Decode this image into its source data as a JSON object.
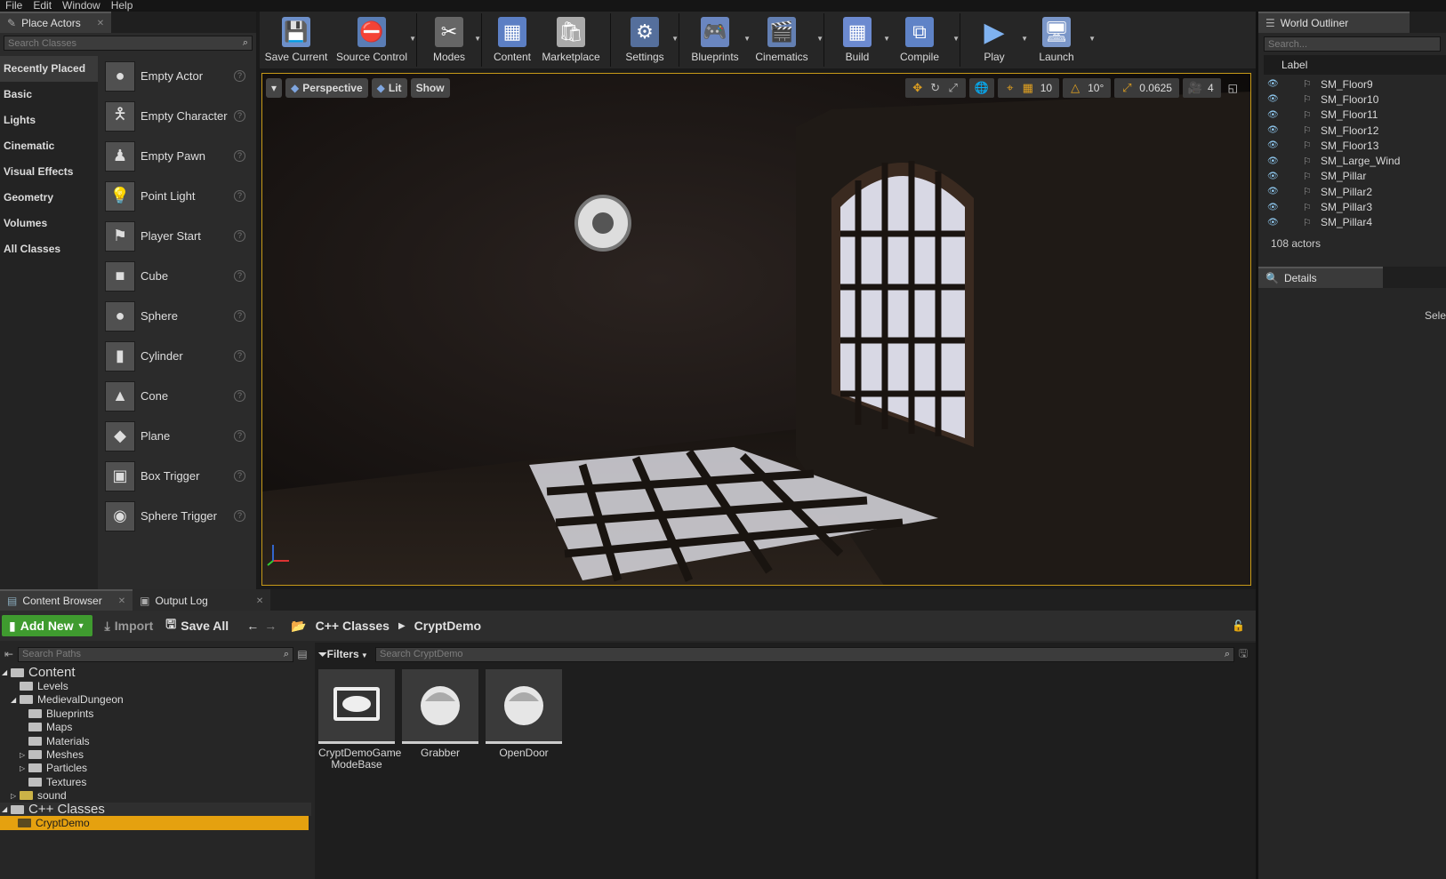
{
  "menu": [
    "File",
    "Edit",
    "Window",
    "Help"
  ],
  "place_actors": {
    "tab": "Place Actors",
    "search_placeholder": "Search Classes",
    "categories": [
      "Recently Placed",
      "Basic",
      "Lights",
      "Cinematic",
      "Visual Effects",
      "Geometry",
      "Volumes",
      "All Classes"
    ],
    "items": [
      "Empty Actor",
      "Empty Character",
      "Empty Pawn",
      "Point Light",
      "Player Start",
      "Cube",
      "Sphere",
      "Cylinder",
      "Cone",
      "Plane",
      "Box Trigger",
      "Sphere Trigger"
    ]
  },
  "toolbar": [
    "Save Current",
    "Source Control",
    "Modes",
    "Content",
    "Marketplace",
    "Settings",
    "Blueprints",
    "Cinematics",
    "Build",
    "Compile",
    "Play",
    "Launch"
  ],
  "viewport": {
    "perspective": "Perspective",
    "lit": "Lit",
    "show": "Show",
    "grid_snap": "10",
    "rot_snap": "10°",
    "scale_snap": "0.0625",
    "cam_speed": "4"
  },
  "outliner": {
    "tab": "World Outliner",
    "search_placeholder": "Search...",
    "column": "Label",
    "items": [
      "SM_Floor9",
      "SM_Floor10",
      "SM_Floor11",
      "SM_Floor12",
      "SM_Floor13",
      "SM_Large_Wind",
      "SM_Pillar",
      "SM_Pillar2",
      "SM_Pillar3",
      "SM_Pillar4"
    ],
    "count": "108 actors"
  },
  "details": {
    "tab": "Details",
    "hint": "Sele"
  },
  "content_browser": {
    "tabs": [
      "Content Browser",
      "Output Log"
    ],
    "add_new": "Add New",
    "import": "Import",
    "save_all": "Save All",
    "path": [
      "C++ Classes",
      "CryptDemo"
    ],
    "search_paths": "Search Paths",
    "filters": "Filters",
    "search_assets": "Search CryptDemo",
    "tree": [
      {
        "label": "Content",
        "depth": 0
      },
      {
        "label": "Levels",
        "depth": 1
      },
      {
        "label": "MedievalDungeon",
        "depth": 1
      },
      {
        "label": "Blueprints",
        "depth": 2
      },
      {
        "label": "Maps",
        "depth": 2
      },
      {
        "label": "Materials",
        "depth": 2
      },
      {
        "label": "Meshes",
        "depth": 2
      },
      {
        "label": "Particles",
        "depth": 2
      },
      {
        "label": "Textures",
        "depth": 2
      },
      {
        "label": "sound",
        "depth": 1
      },
      {
        "label": "C++ Classes",
        "depth": 0
      },
      {
        "label": "CryptDemo",
        "depth": 1
      }
    ],
    "assets": [
      "CryptDemoGame ModeBase",
      "Grabber",
      "OpenDoor"
    ]
  }
}
